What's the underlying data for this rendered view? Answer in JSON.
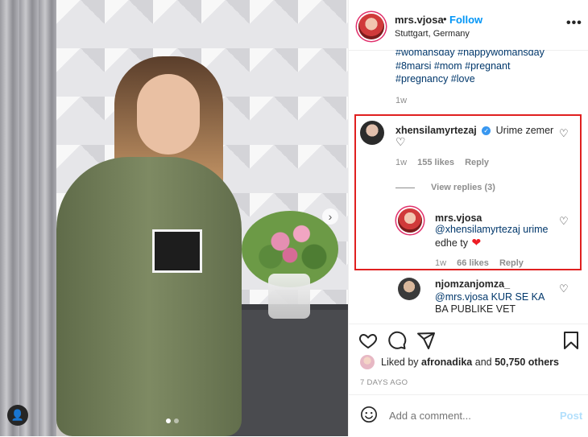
{
  "post": {
    "username": "mrs.vjosa",
    "follow_label": "Follow",
    "location": "Stuttgart, Germany",
    "separator": "•",
    "more": "•••"
  },
  "caption": {
    "lines": [
      "#womansday #happywomansday",
      "#8marsi #mom #pregnant",
      "#pregnancy #love"
    ],
    "time": "1w"
  },
  "comments": [
    {
      "username": "xhensilamyrtezaj",
      "verified": true,
      "text_line1": "Urime zemer",
      "text_line2": "♡",
      "time": "1w",
      "likes": "155 likes",
      "reply_label": "Reply",
      "view_replies": "View replies (3)",
      "reply": {
        "username": "mrs.vjosa",
        "text_line1": "@xhensilamyrtezaj urime",
        "text_line2": "edhe ty",
        "emoji": "❤",
        "time": "1w",
        "likes": "66 likes",
        "reply_label": "Reply"
      }
    },
    {
      "username": "njomzanjomza_",
      "text_line1": "@mrs.vjosa KUR SE KA",
      "text_line2": "BA PUBLIKE VET"
    }
  ],
  "likes": {
    "prefix": "Liked by",
    "user": "afronadika",
    "and": "and",
    "others": "50,750 others"
  },
  "post_time": "7 DAYS AGO",
  "add_comment": {
    "placeholder": "Add a comment...",
    "post_label": "Post"
  },
  "colors": {
    "accent": "#0095f6",
    "highlight_border": "#e02020",
    "heart_red": "#ed1c24"
  },
  "icons": [
    "heart-icon",
    "comment-icon",
    "share-icon",
    "bookmark-icon",
    "emoji-icon",
    "user-tag-icon",
    "chevron-right-icon"
  ]
}
